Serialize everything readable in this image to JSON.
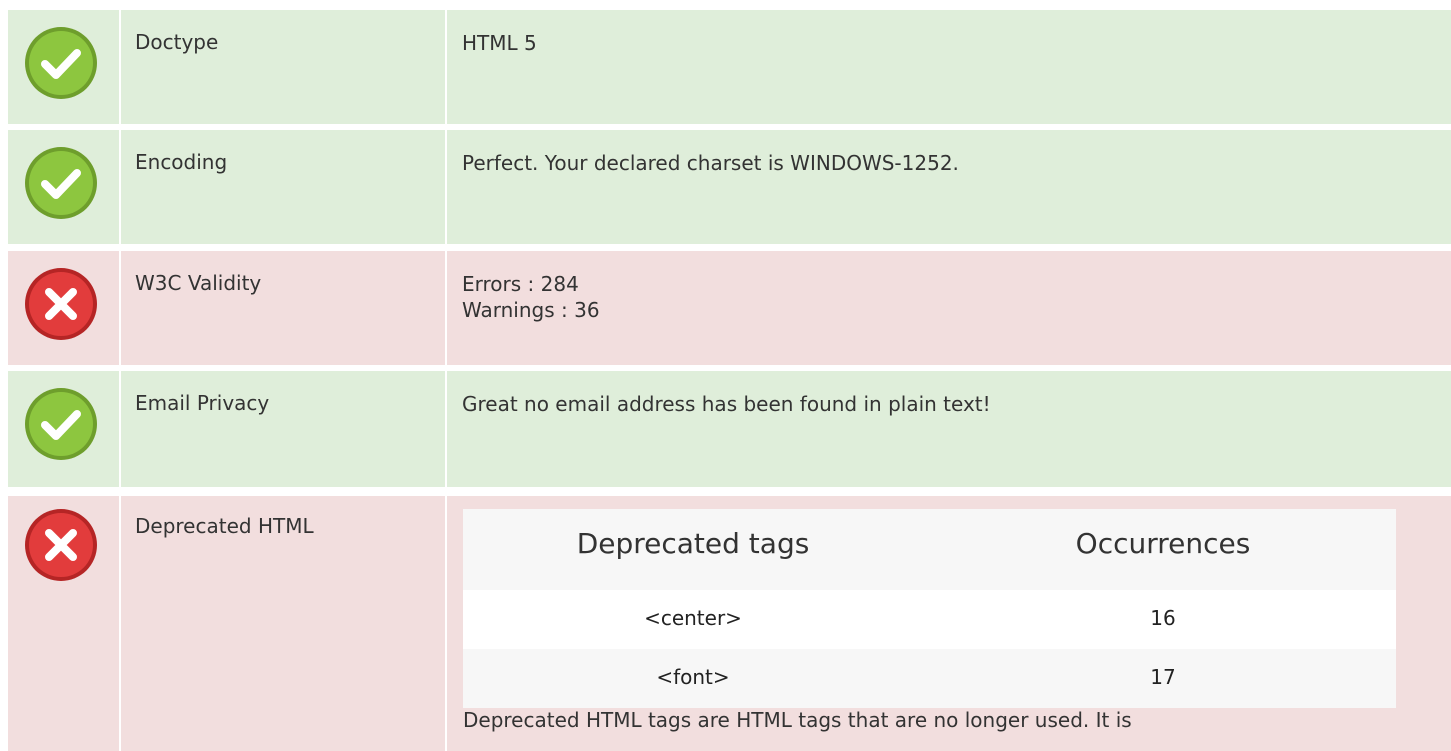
{
  "colors": {
    "pass_bg": "#dfeeda",
    "fail_bg": "#f2dede",
    "pass_icon": "#8dc63f",
    "fail_icon": "#e23c3c"
  },
  "checks": [
    {
      "status": "pass",
      "icon": "check-circle-icon",
      "label": "Doctype",
      "value_lines": [
        "HTML 5"
      ]
    },
    {
      "status": "pass",
      "icon": "check-circle-icon",
      "label": "Encoding",
      "value_lines": [
        "Perfect. Your declared charset is WINDOWS-1252."
      ]
    },
    {
      "status": "fail",
      "icon": "x-circle-icon",
      "label": "W3C Validity",
      "value_lines": [
        "Errors : 284",
        "Warnings : 36"
      ]
    },
    {
      "status": "pass",
      "icon": "check-circle-icon",
      "label": "Email Privacy",
      "value_lines": [
        "Great no email address has been found in plain text!"
      ]
    },
    {
      "status": "fail",
      "icon": "x-circle-icon",
      "label": "Deprecated HTML"
    }
  ],
  "deprecated": {
    "col_tags": "Deprecated tags",
    "col_occurrences": "Occurrences",
    "rows": [
      {
        "tag": "<center>",
        "count": "16"
      },
      {
        "tag": "<font>",
        "count": "17"
      }
    ],
    "note": "Deprecated HTML tags are HTML tags that are no longer used. It is"
  }
}
